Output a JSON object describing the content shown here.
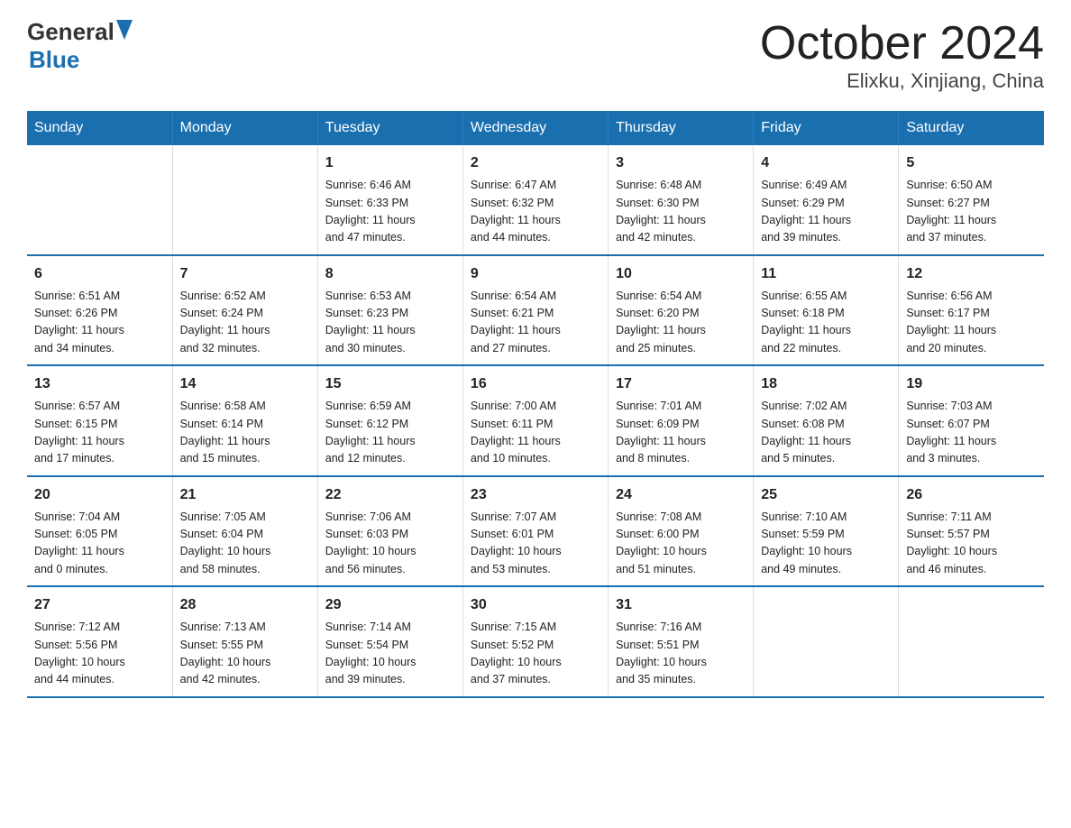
{
  "header": {
    "logo_general": "General",
    "logo_blue": "Blue",
    "title": "October 2024",
    "subtitle": "Elixku, Xinjiang, China"
  },
  "days_of_week": [
    "Sunday",
    "Monday",
    "Tuesday",
    "Wednesday",
    "Thursday",
    "Friday",
    "Saturday"
  ],
  "weeks": [
    [
      {
        "day": "",
        "info": ""
      },
      {
        "day": "",
        "info": ""
      },
      {
        "day": "1",
        "info": "Sunrise: 6:46 AM\nSunset: 6:33 PM\nDaylight: 11 hours\nand 47 minutes."
      },
      {
        "day": "2",
        "info": "Sunrise: 6:47 AM\nSunset: 6:32 PM\nDaylight: 11 hours\nand 44 minutes."
      },
      {
        "day": "3",
        "info": "Sunrise: 6:48 AM\nSunset: 6:30 PM\nDaylight: 11 hours\nand 42 minutes."
      },
      {
        "day": "4",
        "info": "Sunrise: 6:49 AM\nSunset: 6:29 PM\nDaylight: 11 hours\nand 39 minutes."
      },
      {
        "day": "5",
        "info": "Sunrise: 6:50 AM\nSunset: 6:27 PM\nDaylight: 11 hours\nand 37 minutes."
      }
    ],
    [
      {
        "day": "6",
        "info": "Sunrise: 6:51 AM\nSunset: 6:26 PM\nDaylight: 11 hours\nand 34 minutes."
      },
      {
        "day": "7",
        "info": "Sunrise: 6:52 AM\nSunset: 6:24 PM\nDaylight: 11 hours\nand 32 minutes."
      },
      {
        "day": "8",
        "info": "Sunrise: 6:53 AM\nSunset: 6:23 PM\nDaylight: 11 hours\nand 30 minutes."
      },
      {
        "day": "9",
        "info": "Sunrise: 6:54 AM\nSunset: 6:21 PM\nDaylight: 11 hours\nand 27 minutes."
      },
      {
        "day": "10",
        "info": "Sunrise: 6:54 AM\nSunset: 6:20 PM\nDaylight: 11 hours\nand 25 minutes."
      },
      {
        "day": "11",
        "info": "Sunrise: 6:55 AM\nSunset: 6:18 PM\nDaylight: 11 hours\nand 22 minutes."
      },
      {
        "day": "12",
        "info": "Sunrise: 6:56 AM\nSunset: 6:17 PM\nDaylight: 11 hours\nand 20 minutes."
      }
    ],
    [
      {
        "day": "13",
        "info": "Sunrise: 6:57 AM\nSunset: 6:15 PM\nDaylight: 11 hours\nand 17 minutes."
      },
      {
        "day": "14",
        "info": "Sunrise: 6:58 AM\nSunset: 6:14 PM\nDaylight: 11 hours\nand 15 minutes."
      },
      {
        "day": "15",
        "info": "Sunrise: 6:59 AM\nSunset: 6:12 PM\nDaylight: 11 hours\nand 12 minutes."
      },
      {
        "day": "16",
        "info": "Sunrise: 7:00 AM\nSunset: 6:11 PM\nDaylight: 11 hours\nand 10 minutes."
      },
      {
        "day": "17",
        "info": "Sunrise: 7:01 AM\nSunset: 6:09 PM\nDaylight: 11 hours\nand 8 minutes."
      },
      {
        "day": "18",
        "info": "Sunrise: 7:02 AM\nSunset: 6:08 PM\nDaylight: 11 hours\nand 5 minutes."
      },
      {
        "day": "19",
        "info": "Sunrise: 7:03 AM\nSunset: 6:07 PM\nDaylight: 11 hours\nand 3 minutes."
      }
    ],
    [
      {
        "day": "20",
        "info": "Sunrise: 7:04 AM\nSunset: 6:05 PM\nDaylight: 11 hours\nand 0 minutes."
      },
      {
        "day": "21",
        "info": "Sunrise: 7:05 AM\nSunset: 6:04 PM\nDaylight: 10 hours\nand 58 minutes."
      },
      {
        "day": "22",
        "info": "Sunrise: 7:06 AM\nSunset: 6:03 PM\nDaylight: 10 hours\nand 56 minutes."
      },
      {
        "day": "23",
        "info": "Sunrise: 7:07 AM\nSunset: 6:01 PM\nDaylight: 10 hours\nand 53 minutes."
      },
      {
        "day": "24",
        "info": "Sunrise: 7:08 AM\nSunset: 6:00 PM\nDaylight: 10 hours\nand 51 minutes."
      },
      {
        "day": "25",
        "info": "Sunrise: 7:10 AM\nSunset: 5:59 PM\nDaylight: 10 hours\nand 49 minutes."
      },
      {
        "day": "26",
        "info": "Sunrise: 7:11 AM\nSunset: 5:57 PM\nDaylight: 10 hours\nand 46 minutes."
      }
    ],
    [
      {
        "day": "27",
        "info": "Sunrise: 7:12 AM\nSunset: 5:56 PM\nDaylight: 10 hours\nand 44 minutes."
      },
      {
        "day": "28",
        "info": "Sunrise: 7:13 AM\nSunset: 5:55 PM\nDaylight: 10 hours\nand 42 minutes."
      },
      {
        "day": "29",
        "info": "Sunrise: 7:14 AM\nSunset: 5:54 PM\nDaylight: 10 hours\nand 39 minutes."
      },
      {
        "day": "30",
        "info": "Sunrise: 7:15 AM\nSunset: 5:52 PM\nDaylight: 10 hours\nand 37 minutes."
      },
      {
        "day": "31",
        "info": "Sunrise: 7:16 AM\nSunset: 5:51 PM\nDaylight: 10 hours\nand 35 minutes."
      },
      {
        "day": "",
        "info": ""
      },
      {
        "day": "",
        "info": ""
      }
    ]
  ]
}
